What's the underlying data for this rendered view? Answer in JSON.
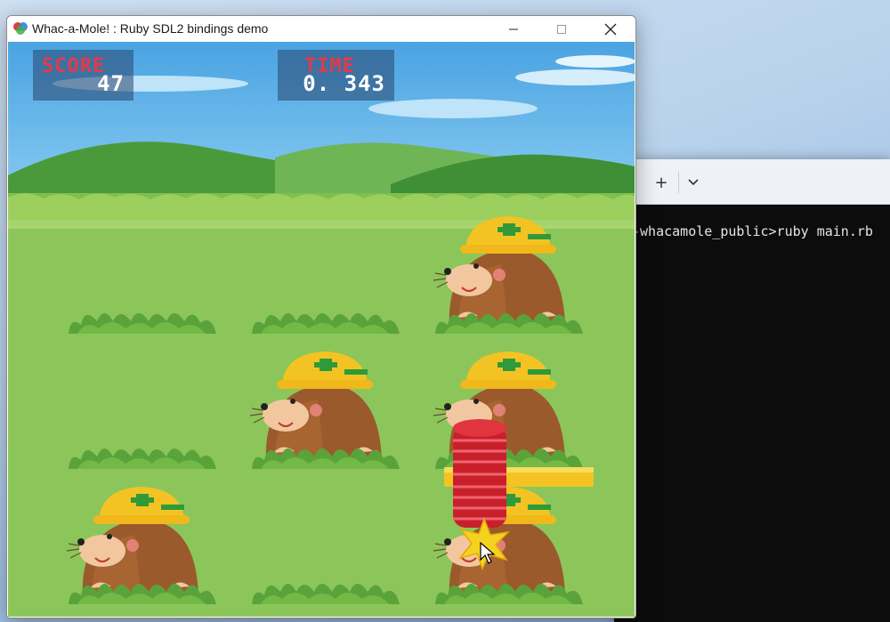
{
  "window": {
    "title": "Whac-a-Mole! : Ruby SDL2 bindings demo"
  },
  "hud": {
    "score_label": "SCORE",
    "score_value": "47",
    "time_label": "TIME",
    "time_value": "0. 343"
  },
  "board": {
    "holes": [
      {
        "row": 1,
        "col": 1,
        "mole": false
      },
      {
        "row": 1,
        "col": 2,
        "mole": false
      },
      {
        "row": 1,
        "col": 3,
        "mole": true
      },
      {
        "row": 2,
        "col": 1,
        "mole": false
      },
      {
        "row": 2,
        "col": 2,
        "mole": true
      },
      {
        "row": 2,
        "col": 3,
        "mole": true
      },
      {
        "row": 3,
        "col": 1,
        "mole": true
      },
      {
        "row": 3,
        "col": 2,
        "mole": false
      },
      {
        "row": 3,
        "col": 3,
        "mole": true
      }
    ]
  },
  "terminal": {
    "new_tab_icon": "plus-icon",
    "dropdown_icon": "chevron-down-icon",
    "command_line": "-whacamole_public>ruby main.rb"
  },
  "colors": {
    "hud_label": "#e3394b",
    "hud_value": "#ffffff",
    "grass": "#8cc65a",
    "sky": "#5aaee6",
    "hammer": "#d9242f"
  }
}
